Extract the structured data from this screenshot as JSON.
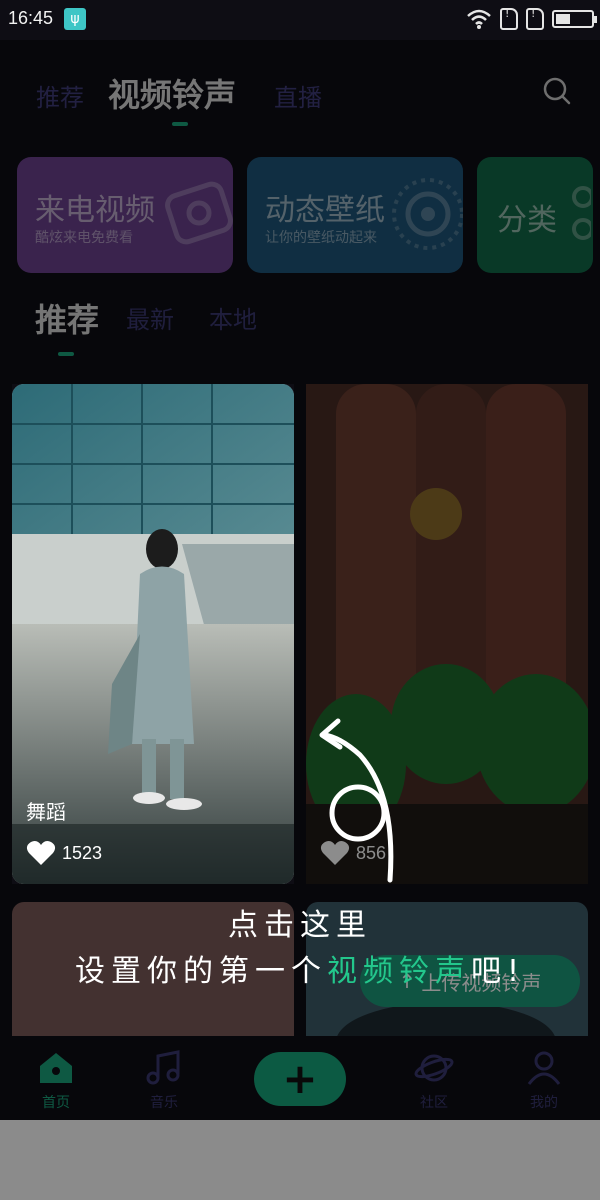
{
  "status_bar": {
    "time": "16:45"
  },
  "top_tabs": [
    {
      "label": "推荐"
    },
    {
      "label": "视频铃声"
    },
    {
      "label": "直播"
    }
  ],
  "categories": [
    {
      "title": "来电视频",
      "subtitle": "酷炫来电免费看",
      "color": "#7a4a9e"
    },
    {
      "title": "动态壁纸",
      "subtitle": "让你的壁纸动起来",
      "color": "#205e80"
    },
    {
      "title": "分类",
      "subtitle": "",
      "color": "#136b4c"
    }
  ],
  "sub_tabs": [
    {
      "label": "推荐"
    },
    {
      "label": "最新"
    },
    {
      "label": "本地"
    }
  ],
  "videos": [
    {
      "label": "舞蹈",
      "likes": "1523"
    },
    {
      "label": "",
      "likes": "856"
    }
  ],
  "hint": {
    "line1": "点击这里",
    "line2_prefix": "设置你的第一个",
    "line2_highlight": "视频铃声",
    "line2_suffix": "吧!"
  },
  "upload_button": {
    "label": "上传视频铃声"
  },
  "bottom_nav": [
    {
      "label": "首页",
      "icon": "home-icon"
    },
    {
      "label": "音乐",
      "icon": "music-icon"
    },
    {
      "label": "社区",
      "icon": "planet-icon"
    },
    {
      "label": "我的",
      "icon": "user-icon"
    }
  ],
  "colors": {
    "accent": "#1aa27a",
    "highlight": "#23c78c",
    "background": "#0e0d14"
  }
}
